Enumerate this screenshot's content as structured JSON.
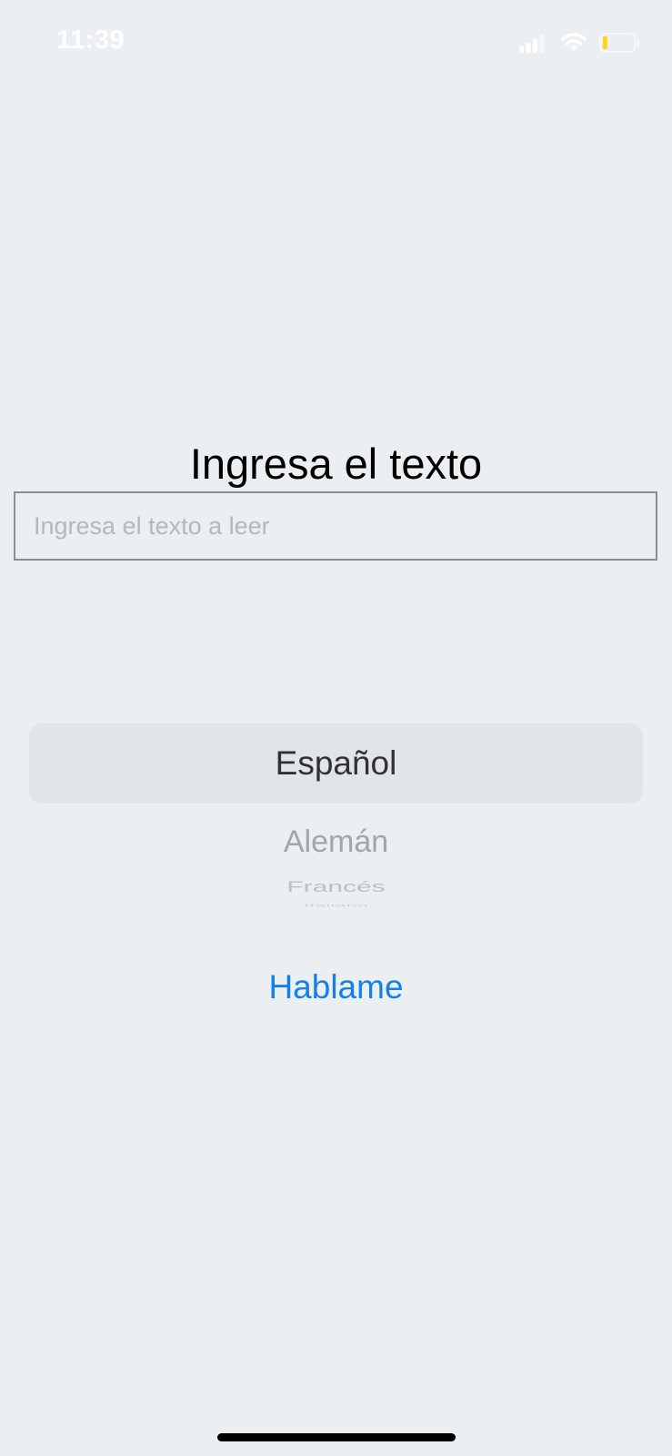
{
  "status_bar": {
    "time": "11:39",
    "signal_icon": "cellular-signal-icon",
    "wifi_icon": "wifi-icon",
    "battery_icon": "battery-icon",
    "battery_color": "#FFD60A",
    "battery_level": 0.15
  },
  "title": "Ingresa el texto",
  "text_input": {
    "value": "",
    "placeholder": "Ingresa el texto a leer"
  },
  "language_picker": {
    "selected": "Español",
    "items": [
      "Español",
      "Alemán",
      "Francés",
      "Italiano"
    ]
  },
  "speak_button": {
    "label": "Hablame",
    "color": "#1580E6"
  },
  "colors": {
    "background": "#ECEFF1",
    "picker_selection": "#E1E5E9"
  }
}
